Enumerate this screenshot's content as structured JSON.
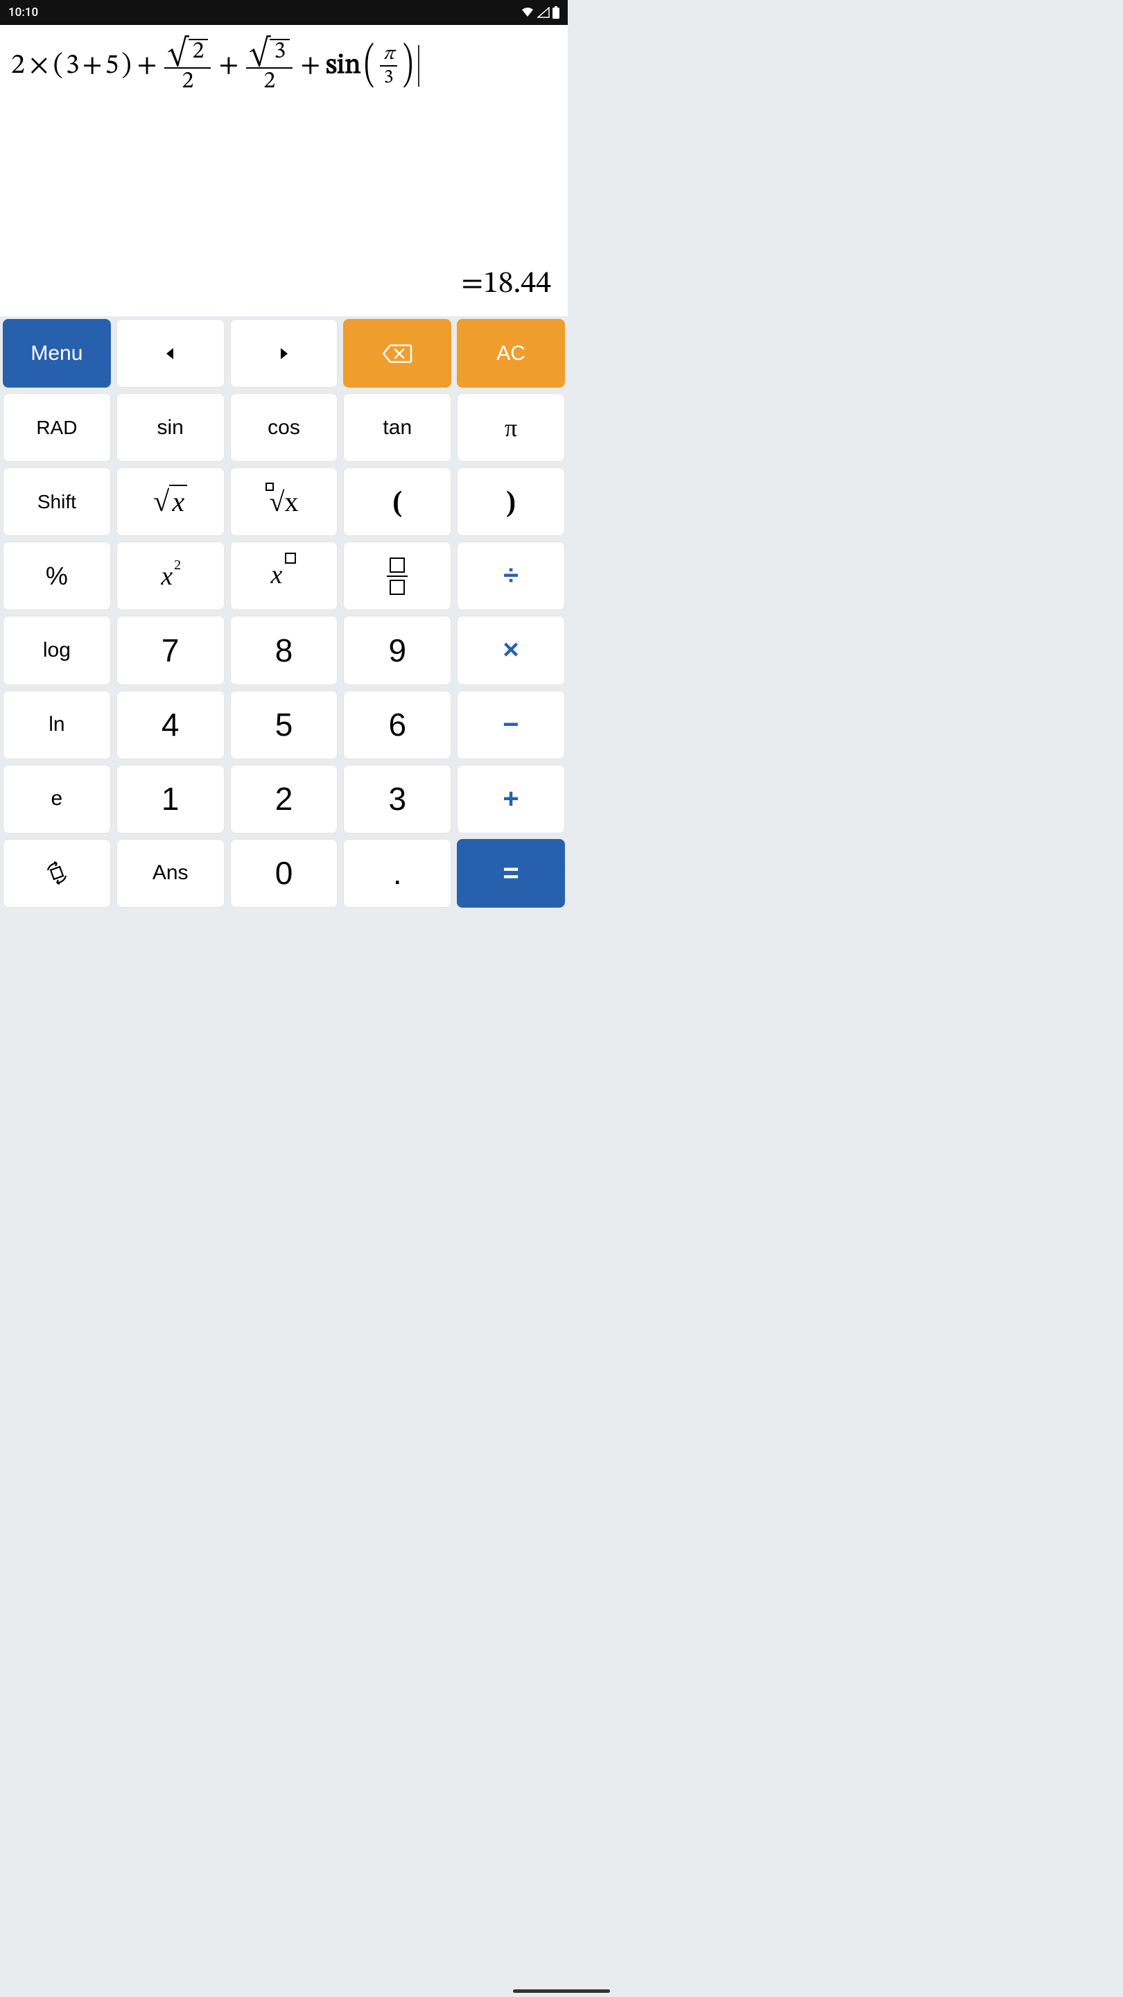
{
  "status": {
    "time": "10:10"
  },
  "display": {
    "expr": {
      "a": "2",
      "times": "×",
      "lp": "(",
      "b": "3",
      "plus1": "+",
      "c": "5",
      "rp": ")",
      "plus2": "+",
      "sqrt2": "2",
      "den2a": "2",
      "plus3": "+",
      "sqrt3": "3",
      "den2b": "2",
      "plus4": "+",
      "sin": "sin",
      "pi": "π",
      "den3": "3"
    },
    "result_prefix": "=",
    "result_value": "18.44"
  },
  "keys": {
    "menu": "Menu",
    "ac": "AC",
    "rad": "RAD",
    "sin": "sin",
    "cos": "cos",
    "tan": "tan",
    "pi": "π",
    "shift": "Shift",
    "lparen": "(",
    "rparen": ")",
    "percent": "%",
    "divide": "÷",
    "log": "log",
    "d7": "7",
    "d8": "8",
    "d9": "9",
    "multiply": "×",
    "ln": "ln",
    "d4": "4",
    "d5": "5",
    "d6": "6",
    "minus": "−",
    "e": "e",
    "d1": "1",
    "d2": "2",
    "d3": "3",
    "plus": "+",
    "ans": "Ans",
    "d0": "0",
    "dot": ".",
    "equals": "=",
    "sqrt_x": "x",
    "nroot_x": "x",
    "xsq_x": "x",
    "xsq_2": "2",
    "xpow_x": "x"
  }
}
